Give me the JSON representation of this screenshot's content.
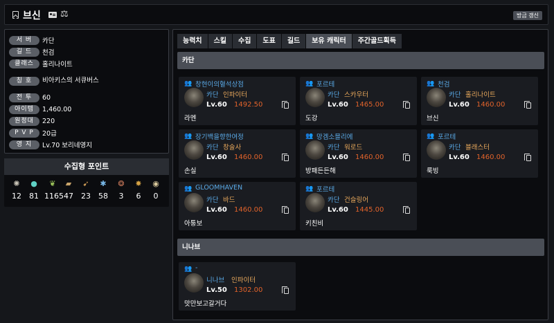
{
  "header": {
    "name": "브신",
    "refresh_label": "방금 갱신"
  },
  "info": [
    {
      "label": "서 버",
      "value": "카단"
    },
    {
      "label": "길 드",
      "value": "천검"
    },
    {
      "label": "클래스",
      "value": "홀리나이트"
    },
    {
      "label": "칭 호",
      "value": "비아키스의 서큐버스"
    },
    {
      "label": "전 투",
      "value": "60"
    },
    {
      "label": "아이템",
      "value": "1,460.00"
    },
    {
      "label": "원정대",
      "value": "220"
    },
    {
      "label": "P V P",
      "value": "20급"
    },
    {
      "label": "영 지",
      "value": "Lv.70 보리네영지"
    }
  ],
  "collect": {
    "title": "수집형 포인트",
    "items": [
      {
        "icon": "island-heart-icon",
        "value": "12",
        "color": "#c9c4b7"
      },
      {
        "icon": "orpheus-star-icon",
        "value": "81",
        "color": "#5fd0c5"
      },
      {
        "icon": "giant-heart-icon",
        "value": "1165",
        "color": "#9bc35a"
      },
      {
        "icon": "art-icon",
        "value": "47",
        "color": "#c9a46a"
      },
      {
        "icon": "voyage-icon",
        "value": "23",
        "color": "#d4a058"
      },
      {
        "icon": "world-tree-leaf-icon",
        "value": "58",
        "color": "#79b8e8"
      },
      {
        "icon": "mokoko-seed-icon",
        "value": "3",
        "color": "#c9785a"
      },
      {
        "icon": "sea-bounty-icon",
        "value": "6",
        "color": "#d6a345"
      },
      {
        "icon": "ignea-token-icon",
        "value": "0",
        "color": "#d8c79a"
      }
    ]
  },
  "tabs": [
    "능력치",
    "스킬",
    "수집",
    "도표",
    "길드",
    "보유 캐릭터",
    "주간골드획득"
  ],
  "active_tab": 5,
  "sections": [
    {
      "title": "카단",
      "characters": [
        {
          "guild": "창현이의혈석상점",
          "server": "카단",
          "class": "인파이터",
          "level": "Lv.60",
          "item_level": "1492.50",
          "name": "라멘"
        },
        {
          "guild": "포르테",
          "server": "카단",
          "class": "스카우터",
          "level": "Lv.60",
          "item_level": "1465.00",
          "name": "도강"
        },
        {
          "guild": "천검",
          "server": "카단",
          "class": "홀리나이트",
          "level": "Lv.60",
          "item_level": "1460.00",
          "name": "브신"
        },
        {
          "guild": "장기백을향한여정",
          "server": "카단",
          "class": "창술사",
          "level": "Lv.60",
          "item_level": "1460.00",
          "name": "손실"
        },
        {
          "guild": "망겜소믈리에",
          "server": "카단",
          "class": "워로드",
          "level": "Lv.60",
          "item_level": "1460.00",
          "name": "방패든든해"
        },
        {
          "guild": "포르테",
          "server": "카단",
          "class": "블래스터",
          "level": "Lv.60",
          "item_level": "1460.00",
          "name": "룩빙"
        },
        {
          "guild": "GLOOMHAVEN",
          "server": "카단",
          "class": "바드",
          "level": "Lv.60",
          "item_level": "1460.00",
          "name": "아퉁보"
        },
        {
          "guild": "포르테",
          "server": "카단",
          "class": "건슬링어",
          "level": "Lv.60",
          "item_level": "1445.00",
          "name": "키친비"
        }
      ]
    },
    {
      "title": "니나브",
      "characters": [
        {
          "guild": "-",
          "server": "니나브",
          "class": "인파이터",
          "level": "Lv.50",
          "item_level": "1302.00",
          "name": "맛만보고갈거다"
        }
      ]
    }
  ]
}
